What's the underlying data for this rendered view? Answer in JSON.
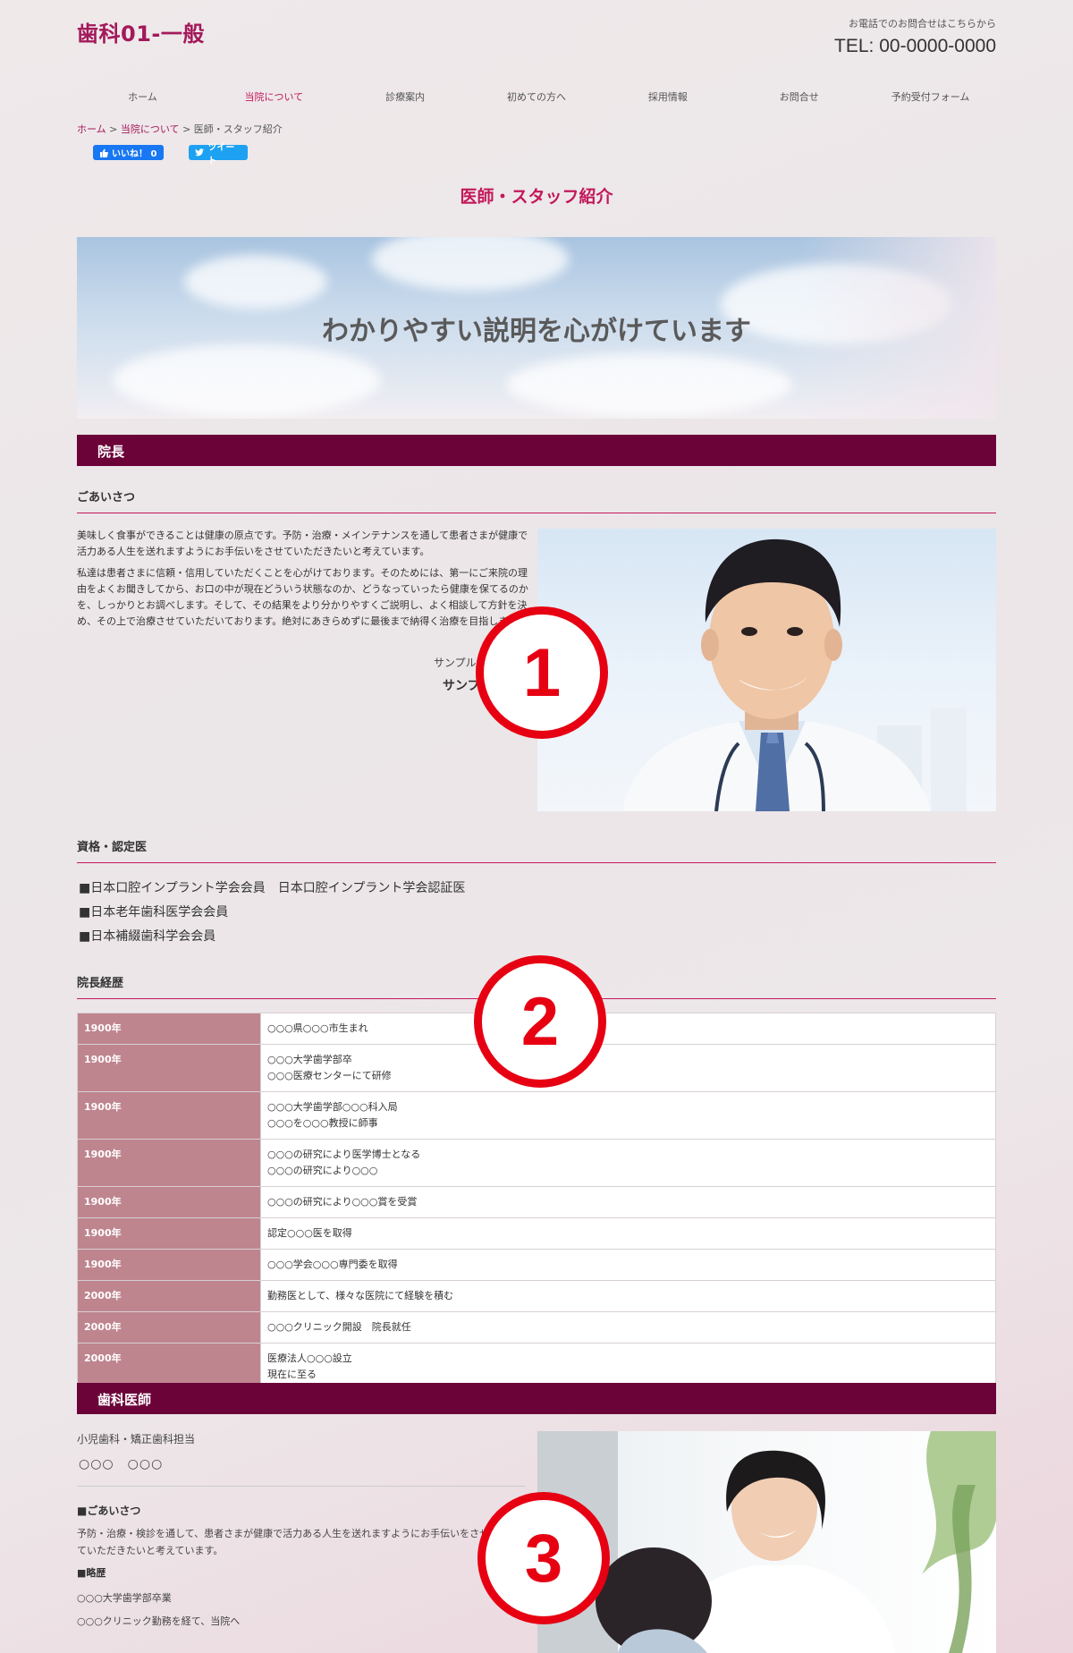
{
  "header": {
    "site_title": "歯科01-一般",
    "contact_note": "お電話でのお問合せはこちらから",
    "tel": "TEL: 00-0000-0000"
  },
  "nav": [
    "ホーム",
    "当院について",
    "診療案内",
    "初めての方へ",
    "採用情報",
    "お問合せ",
    "予約受付フォーム"
  ],
  "breadcrumb": {
    "home": "ホーム",
    "about": "当院について",
    "sep": ">",
    "current": "医師・スタッフ紹介"
  },
  "social": {
    "like": "いいね！ 0",
    "tweet": "ツイート"
  },
  "page_title": "医師・スタッフ紹介",
  "hero_text": "わかりやすい説明を心がけています",
  "director": {
    "bar": "院長",
    "greeting_heading": "ごあいさつ",
    "para1": "美味しく食事ができることは健康の原点です。予防・治療・メインテナンスを通して患者さまが健康で活力ある人生を送れますようにお手伝いをさせていただきたいと考えています。",
    "para2": "私達は患者さまに信頼・信用していただくことを心がけております。そのためには、第一にご来院の理由をよくお聞きしてから、お口の中が現在どういう状態なのか、どうなっていったら健康を保てるのかを、しっかりとお調べします。そして、その結果をより分かりやすくご説明し、よく相談して方針を決め、その上で治療させていただいております。絶対にあきらめずに最後まで納得く治療を目指します。",
    "sign_small": "サンプル",
    "sign_big": "サンプ",
    "qual_heading": "資格・認定医",
    "qualifications": [
      "■日本口腔インプラント学会会員　日本口腔インプラント学会認証医",
      "■日本老年歯科医学会会員",
      "■日本補綴歯科学会会員"
    ],
    "history_heading": "院長経歴",
    "history": [
      {
        "year": "1900年",
        "lines": [
          "○○○県○○○市生まれ"
        ]
      },
      {
        "year": "1900年",
        "lines": [
          "○○○大学歯学部卒",
          "○○○医療センターにて研修"
        ]
      },
      {
        "year": "1900年",
        "lines": [
          "○○○大学歯学部○○○科入局",
          "○○○を○○○教授に師事"
        ]
      },
      {
        "year": "1900年",
        "lines": [
          "○○○の研究により医学博士となる",
          "○○○の研究により○○○"
        ]
      },
      {
        "year": "1900年",
        "lines": [
          "○○○の研究により○○○賞を受賞"
        ]
      },
      {
        "year": "1900年",
        "lines": [
          "認定○○○医を取得"
        ]
      },
      {
        "year": "1900年",
        "lines": [
          "○○○学会○○○専門委を取得"
        ]
      },
      {
        "year": "2000年",
        "lines": [
          "勤務医として、様々な医院にて経験を積む"
        ]
      },
      {
        "year": "2000年",
        "lines": [
          "○○○クリニック開設　院長就任"
        ]
      },
      {
        "year": "2000年",
        "lines": [
          "医療法人○○○設立",
          "現在に至る"
        ]
      }
    ]
  },
  "dentist": {
    "bar": "歯科医師",
    "role": "小児歯科・矯正歯科担当",
    "name": "○○○　○○○",
    "greeting_heading": "■ごあいさつ",
    "greeting": "予防・治療・検診を通して、患者さまが健康で活力ある人生を送れますようにお手伝いをさせていただきたいと考えています。",
    "history_heading": "■略歴",
    "history1": "○○○大学歯学部卒業",
    "history2": "○○○クリニック勤務を経て、当院へ"
  },
  "markers": [
    "1",
    "2",
    "3"
  ],
  "colors": {
    "brand": "#a3195b",
    "bar": "#6b0339",
    "year_cell": "#bf858f",
    "marker": "#e60012"
  }
}
